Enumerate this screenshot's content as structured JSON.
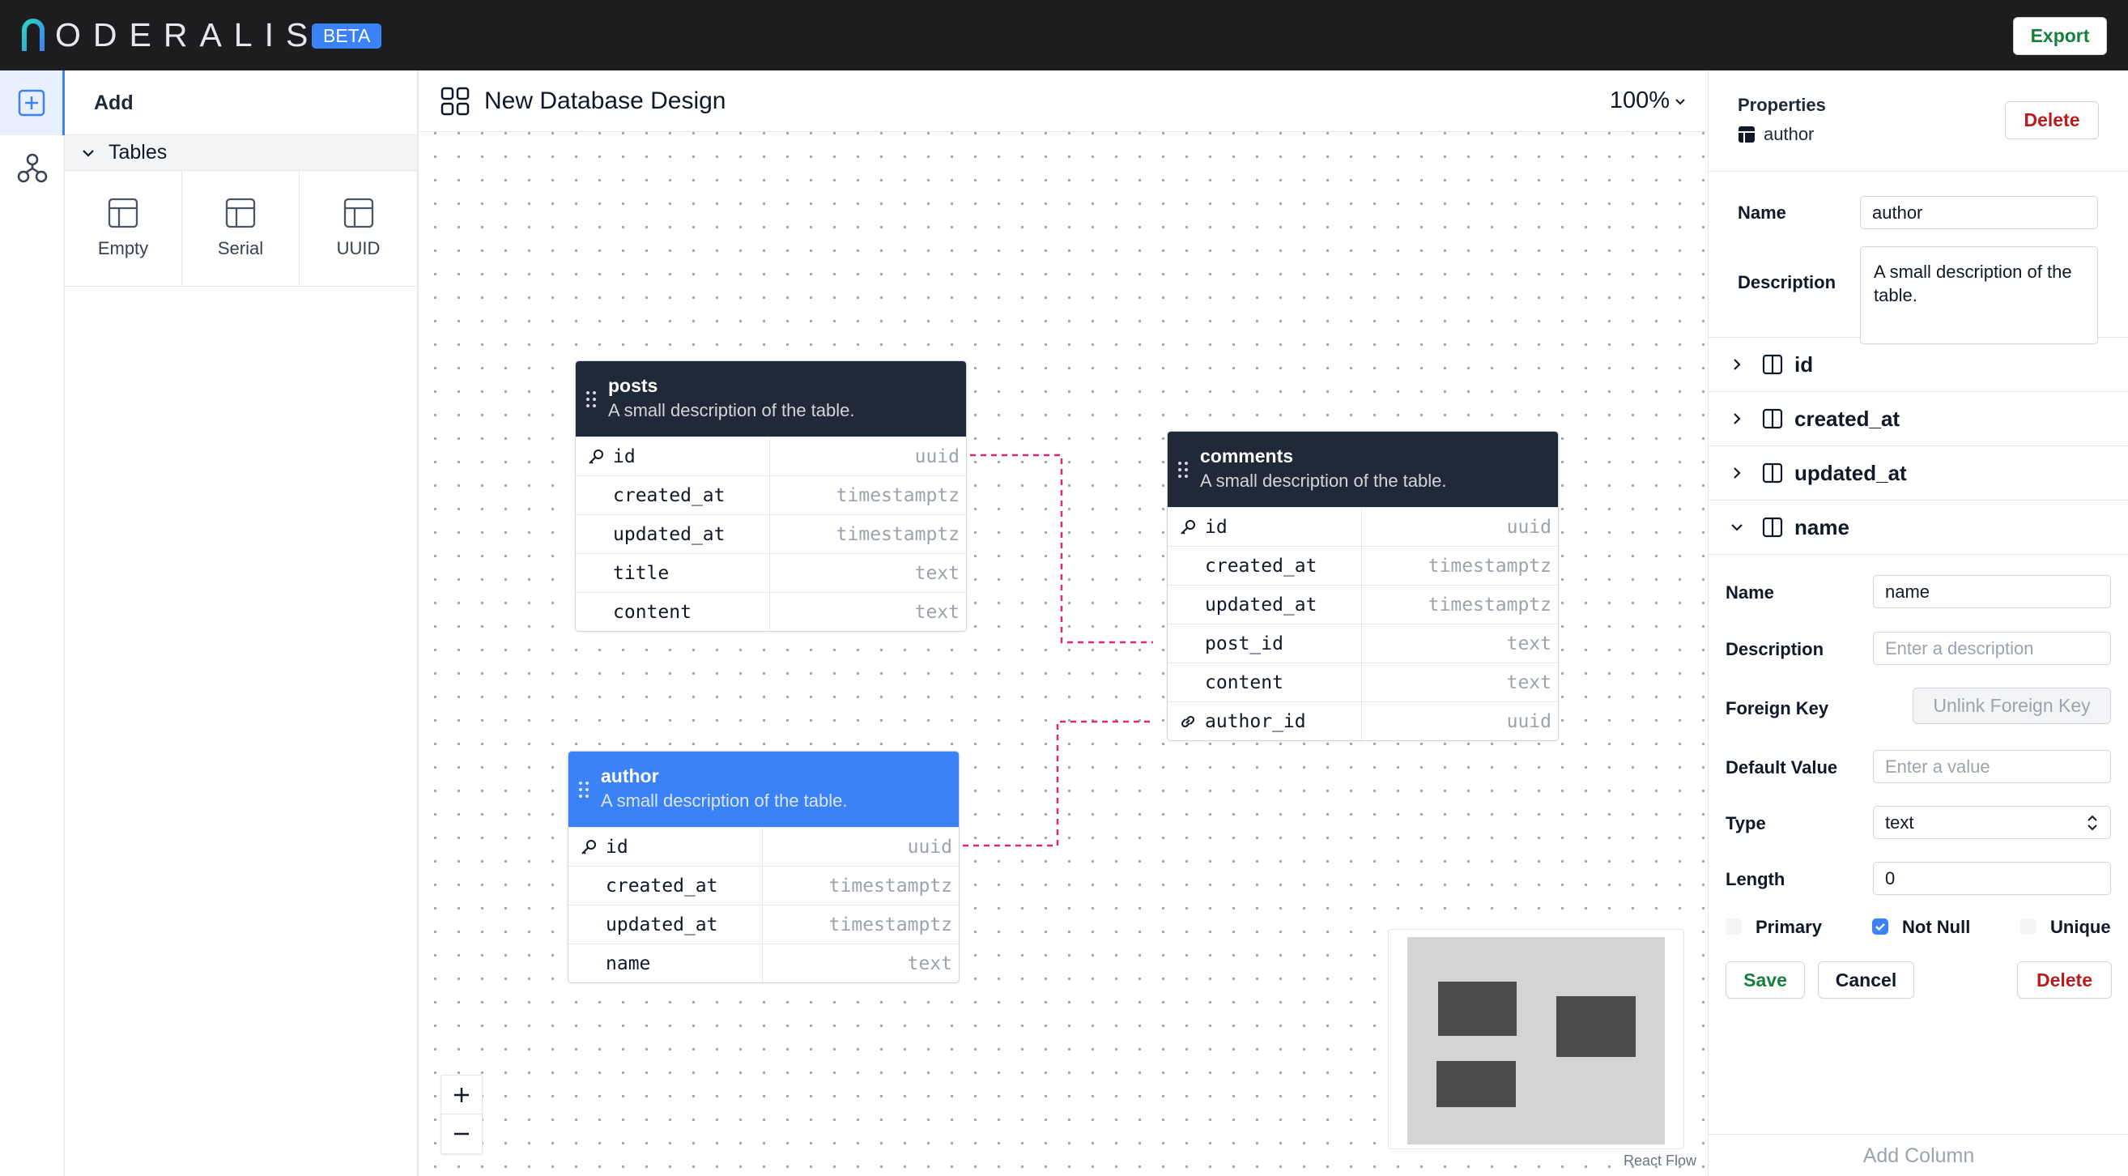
{
  "app": {
    "logo_text": "ODERALIS",
    "beta_label": "BETA",
    "export_label": "Export"
  },
  "add_panel": {
    "title": "Add",
    "section_label": "Tables",
    "templates": [
      {
        "label": "Empty"
      },
      {
        "label": "Serial"
      },
      {
        "label": "UUID"
      }
    ]
  },
  "canvas": {
    "title": "New Database Design",
    "zoom": "100%",
    "attribution": "React Flow",
    "zoom_in": "+",
    "zoom_out": "−",
    "tables": [
      {
        "name": "posts",
        "description": "A small description of the table.",
        "selected": false,
        "columns": [
          {
            "name": "id",
            "type": "uuid",
            "icon": "key-icon"
          },
          {
            "name": "created_at",
            "type": "timestamptz"
          },
          {
            "name": "updated_at",
            "type": "timestamptz"
          },
          {
            "name": "title",
            "type": "text"
          },
          {
            "name": "content",
            "type": "text"
          }
        ]
      },
      {
        "name": "comments",
        "description": "A small description of the table.",
        "selected": false,
        "columns": [
          {
            "name": "id",
            "type": "uuid",
            "icon": "key-icon"
          },
          {
            "name": "created_at",
            "type": "timestamptz"
          },
          {
            "name": "updated_at",
            "type": "timestamptz"
          },
          {
            "name": "post_id",
            "type": "text"
          },
          {
            "name": "content",
            "type": "text"
          },
          {
            "name": "author_id",
            "type": "uuid",
            "icon": "link-icon"
          }
        ]
      },
      {
        "name": "author",
        "description": "A small description of the table.",
        "selected": true,
        "columns": [
          {
            "name": "id",
            "type": "uuid",
            "icon": "key-icon"
          },
          {
            "name": "created_at",
            "type": "timestamptz"
          },
          {
            "name": "updated_at",
            "type": "timestamptz"
          },
          {
            "name": "name",
            "type": "text"
          }
        ]
      }
    ],
    "edge_color": "#db2777"
  },
  "properties": {
    "title": "Properties",
    "subject": "author",
    "delete_label": "Delete",
    "table_name_label": "Name",
    "table_name_value": "author",
    "table_desc_label": "Description",
    "table_desc_value": "A small description of the table.",
    "columns": [
      {
        "name": "id",
        "expanded": false
      },
      {
        "name": "created_at",
        "expanded": false
      },
      {
        "name": "updated_at",
        "expanded": false
      },
      {
        "name": "name",
        "expanded": true
      }
    ],
    "column_form": {
      "name_label": "Name",
      "name_value": "name",
      "description_label": "Description",
      "description_placeholder": "Enter a description",
      "fk_label": "Foreign Key",
      "fk_button": "Unlink Foreign Key",
      "default_label": "Default Value",
      "default_placeholder": "Enter a value",
      "type_label": "Type",
      "type_value": "text",
      "length_label": "Length",
      "length_value": "0",
      "primary_label": "Primary",
      "primary_checked": false,
      "notnull_label": "Not Null",
      "notnull_checked": true,
      "unique_label": "Unique",
      "unique_checked": false,
      "save_label": "Save",
      "cancel_label": "Cancel",
      "delete_label": "Delete"
    },
    "add_column_label": "Add Column"
  },
  "colors": {
    "accent": "#3b82f6",
    "header_dark": "#1f2937",
    "save_green": "#15803d",
    "delete_red": "#b91c1c"
  }
}
